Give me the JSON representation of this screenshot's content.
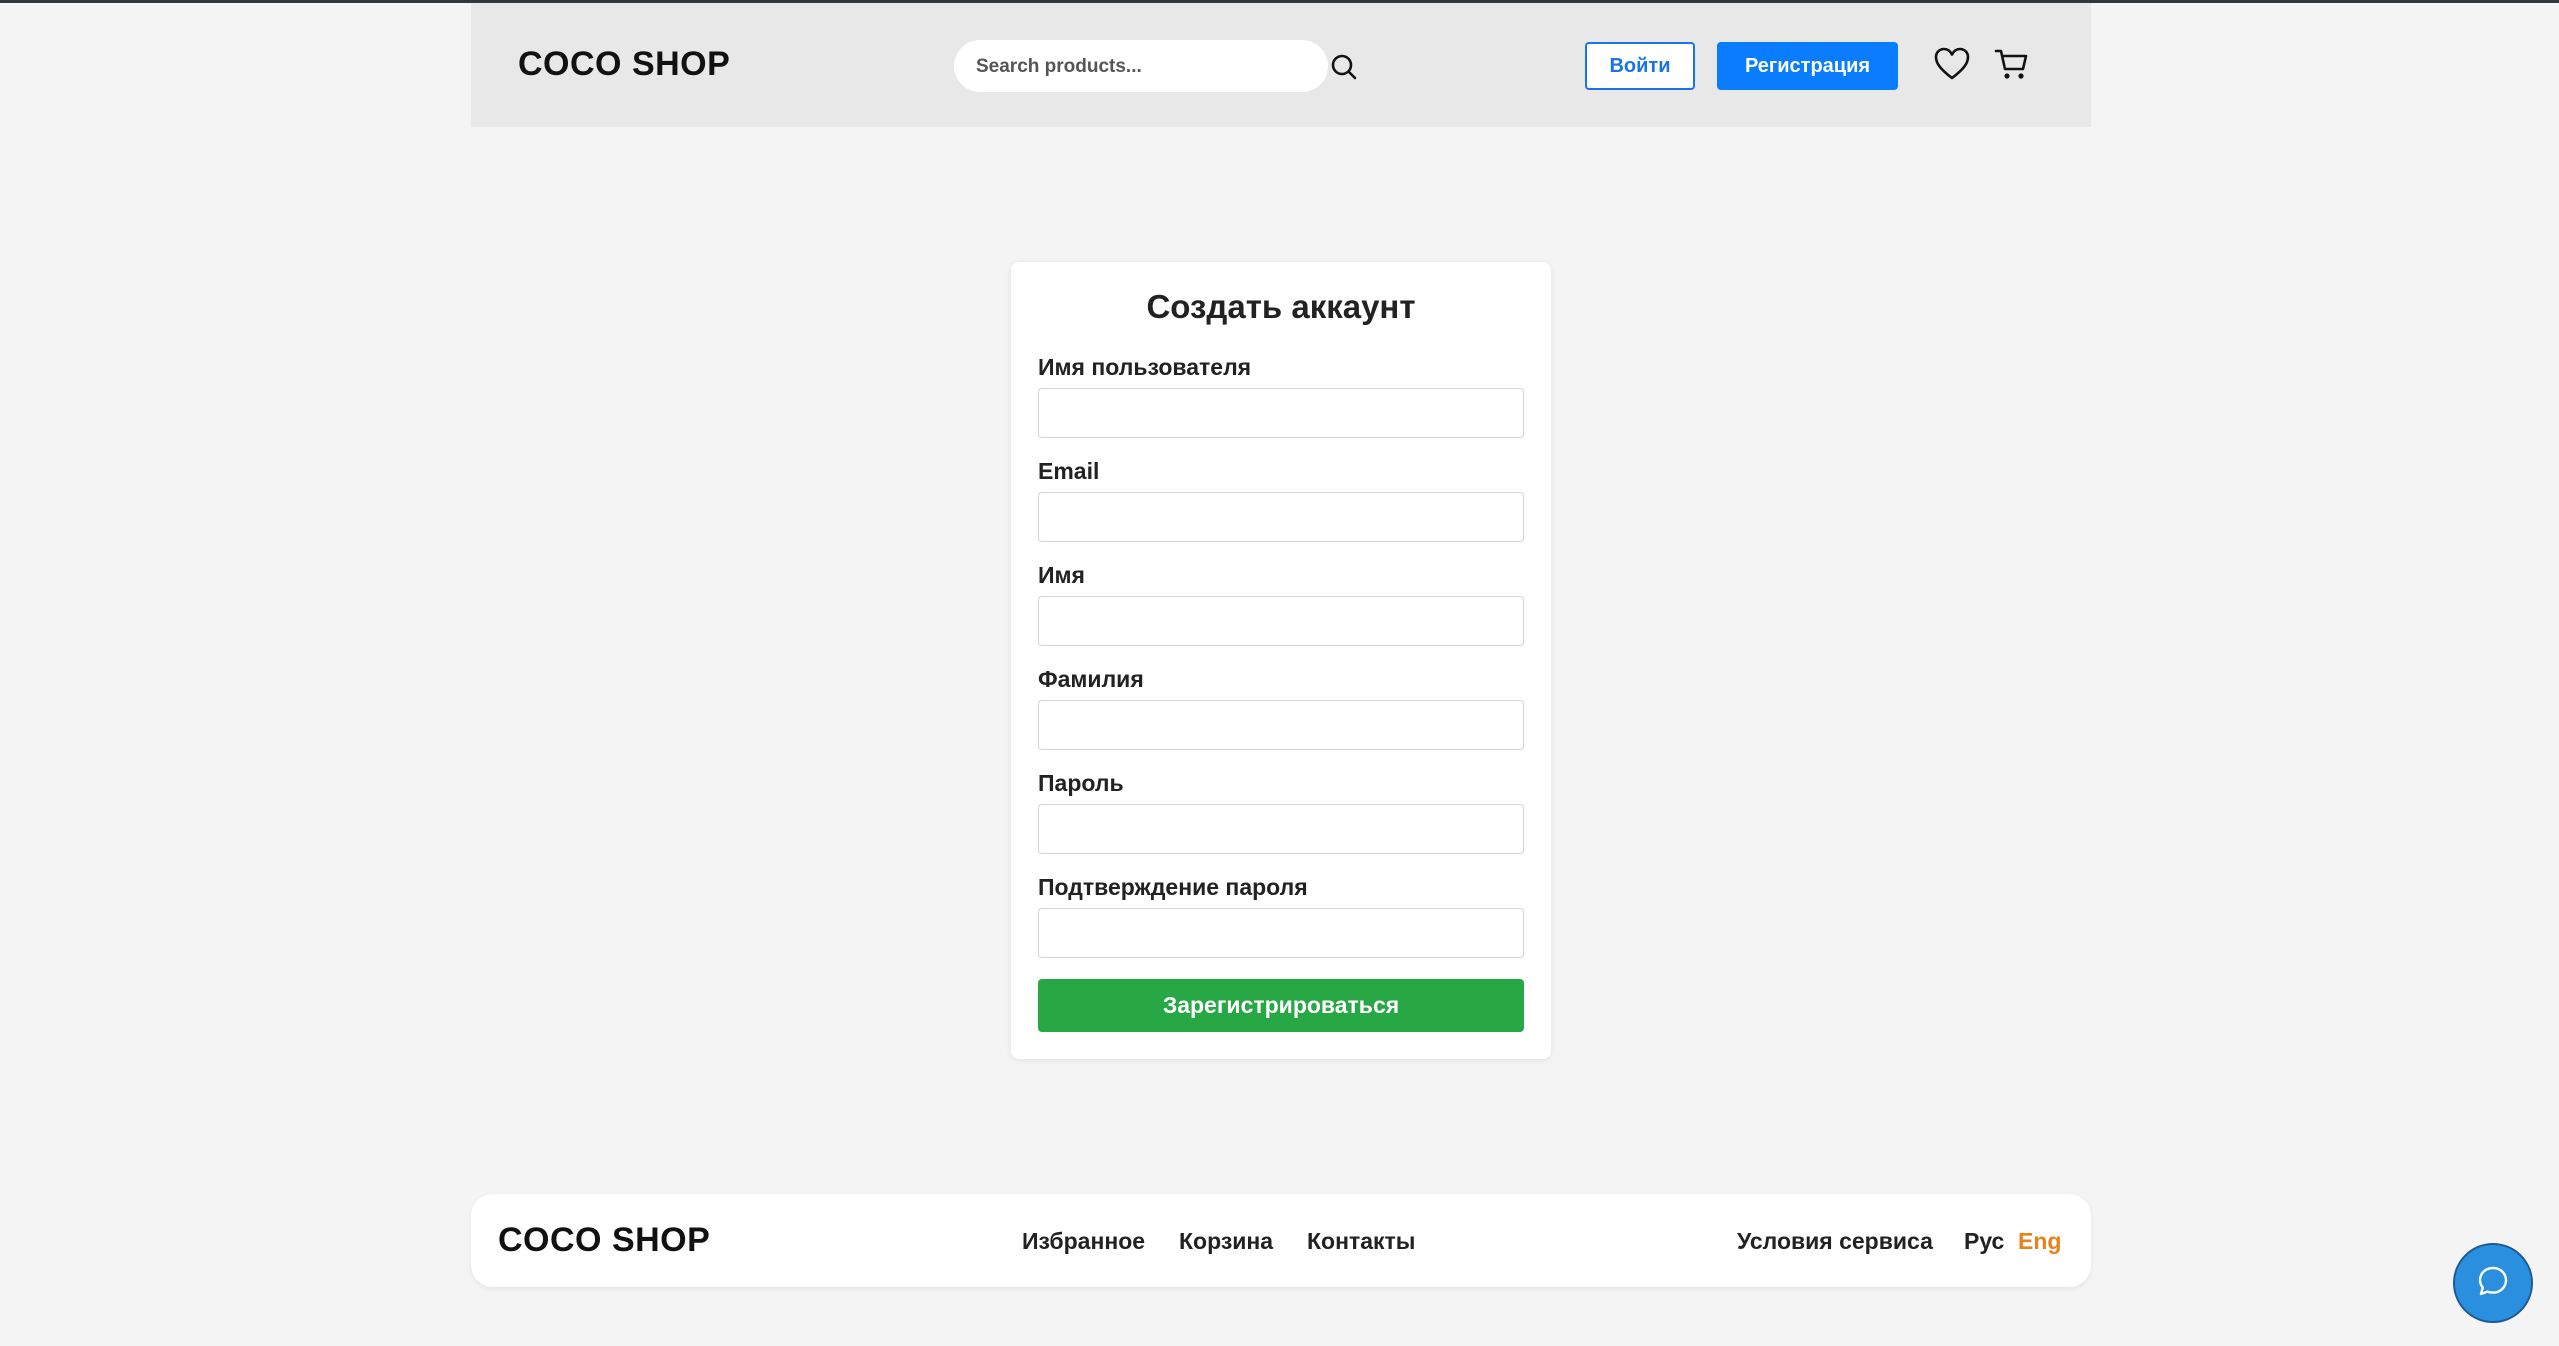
{
  "header": {
    "logo": "COCO SHOP",
    "search_placeholder": "Search products...",
    "login_label": "Войти",
    "register_label": "Регистрация",
    "accent_color": "#0a7cff"
  },
  "form": {
    "title": "Создать аккаунт",
    "fields": [
      {
        "label": "Имя пользователя",
        "value": ""
      },
      {
        "label": "Email",
        "value": ""
      },
      {
        "label": "Имя",
        "value": ""
      },
      {
        "label": "Фамилия",
        "value": ""
      },
      {
        "label": "Пароль",
        "value": ""
      },
      {
        "label": "Подтверждение пароля",
        "value": ""
      }
    ],
    "submit_label": "Зарегистрироваться",
    "submit_color": "#28a745"
  },
  "footer": {
    "logo": "COCO SHOP",
    "links": [
      "Избранное",
      "Корзина",
      "Контакты"
    ],
    "terms": "Условия сервиса",
    "lang_ru": "Рус",
    "lang_en": "Eng",
    "active_lang_color": "#e8821a"
  },
  "icons": {
    "search": "search-icon",
    "favorites": "heart-icon",
    "cart": "cart-icon",
    "chat": "chat-bubble-icon"
  }
}
